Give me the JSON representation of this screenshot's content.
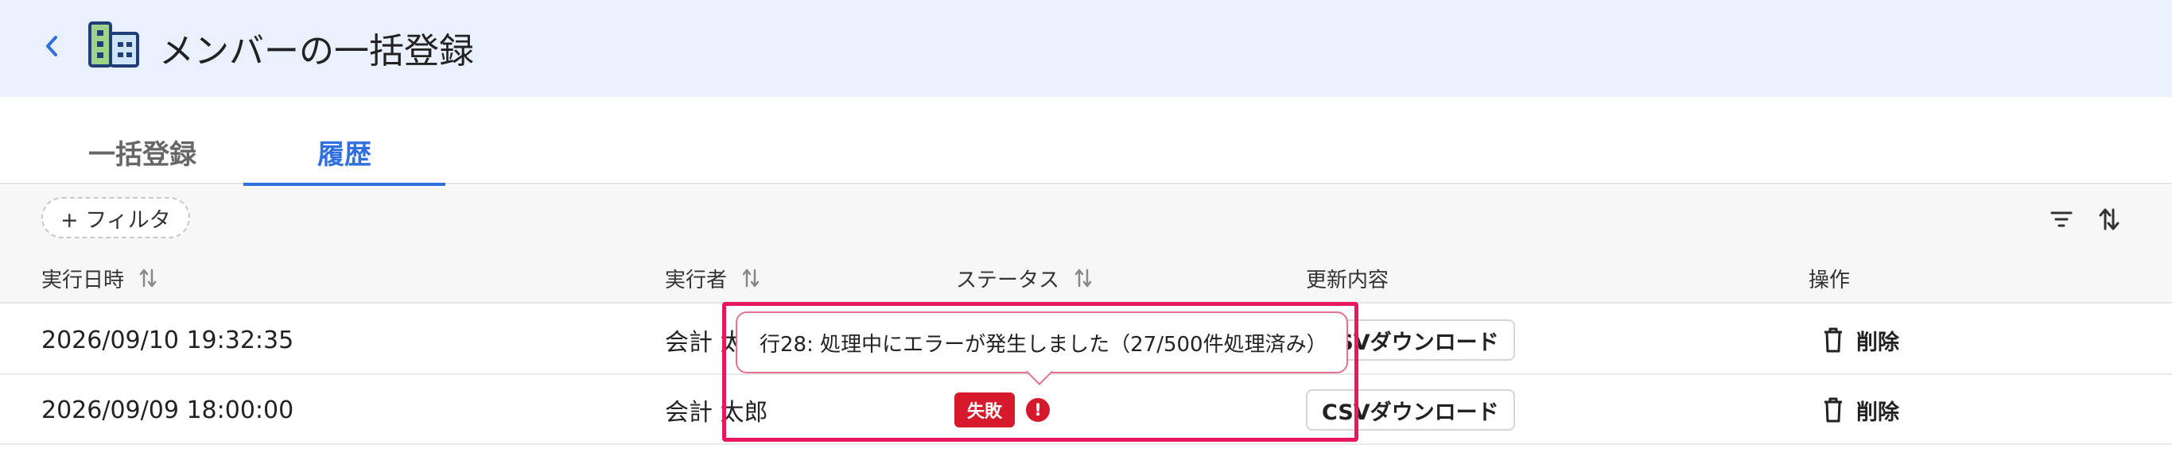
{
  "header": {
    "title": "メンバーの一括登録",
    "back_icon": "chevron-left-icon",
    "app_icon": "building-icon"
  },
  "tabs": [
    {
      "label": "一括登録",
      "active": false
    },
    {
      "label": "履歴",
      "active": true
    }
  ],
  "toolbar": {
    "filter_label": "+ フィルタ",
    "filter_icon": "filter-icon",
    "sort_icon": "sort-icon"
  },
  "table": {
    "columns": [
      {
        "label": "実行日時",
        "sortable": true
      },
      {
        "label": "実行者",
        "sortable": true
      },
      {
        "label": "ステータス",
        "sortable": true
      },
      {
        "label": "更新内容",
        "sortable": false
      },
      {
        "label": "操作",
        "sortable": false
      }
    ],
    "rows": [
      {
        "date": "2026/09/10 19:32:35",
        "executor": "会計 太郎",
        "status": "",
        "download_label": "CSVダウンロード",
        "delete_label": "削除"
      },
      {
        "date": "2026/09/09 18:00:00",
        "executor": "会計 太郎",
        "status": "失敗",
        "download_label": "CSVダウンロード",
        "delete_label": "削除"
      }
    ]
  },
  "tooltip": {
    "text": "行28: 処理中にエラーが発生しました（27/500件処理済み）"
  },
  "colors": {
    "header_bg": "#eaf1fc",
    "accent": "#2f6fde",
    "error": "#d7192c",
    "highlight": "#e8185e"
  }
}
